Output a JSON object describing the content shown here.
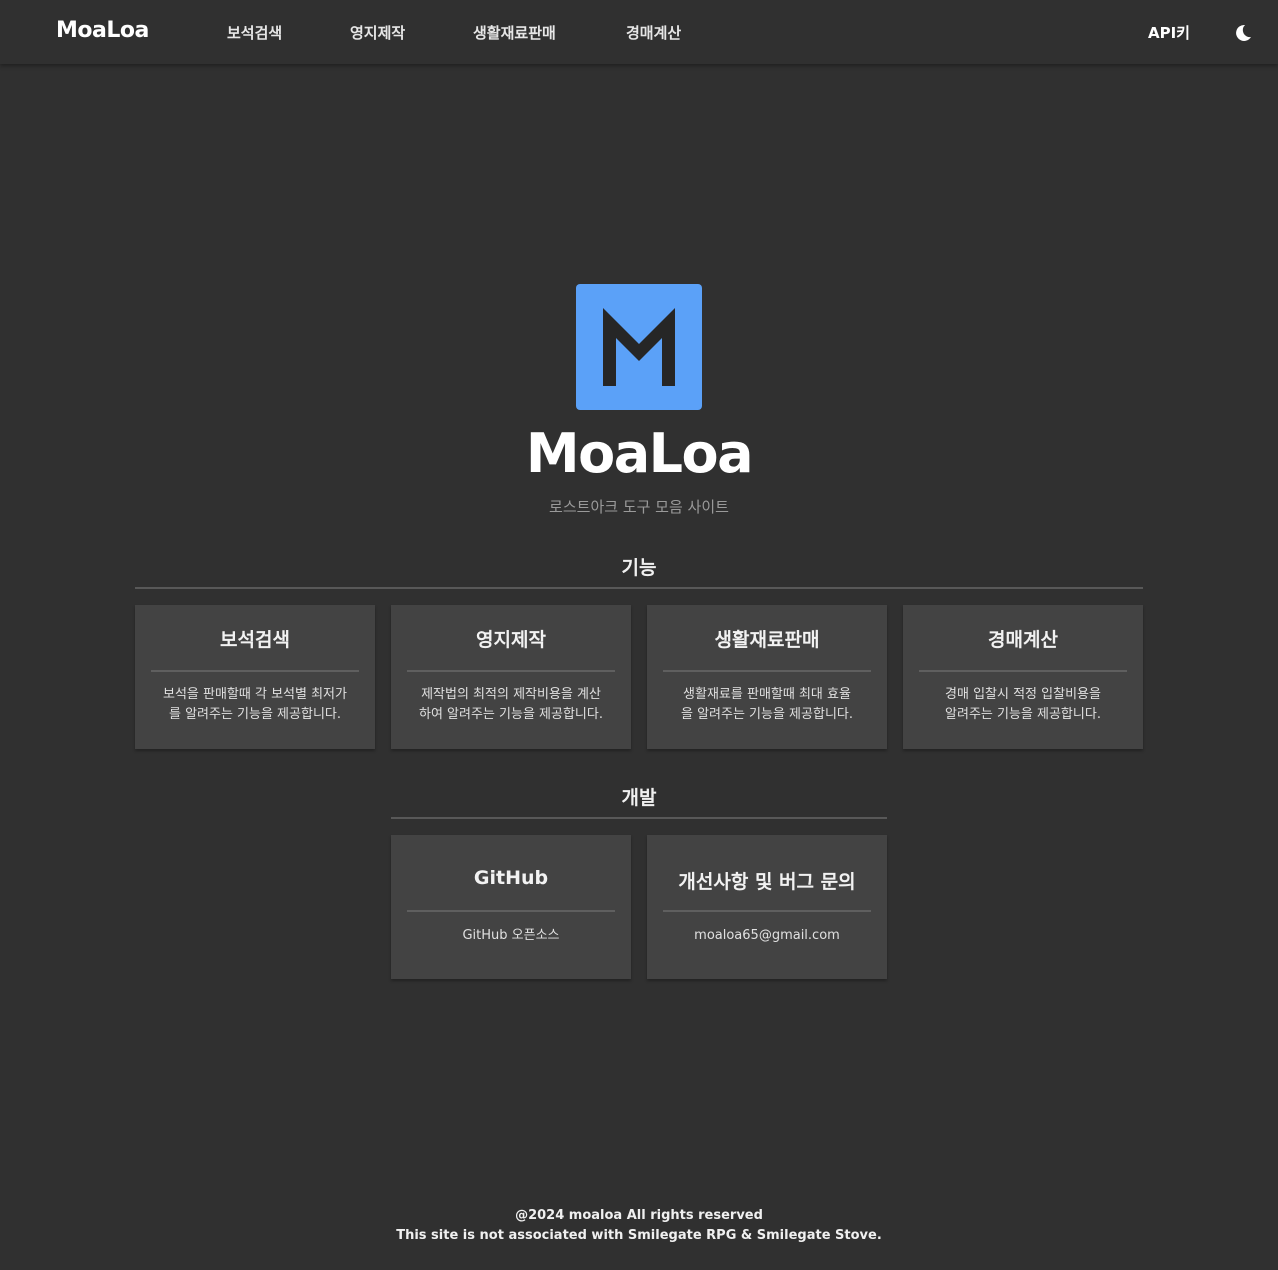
{
  "nav": {
    "brand": "MoaLoa",
    "links": [
      "보석검색",
      "영지제작",
      "생활재료판매",
      "경매계산"
    ],
    "api_label": "API키",
    "theme_icon": "moon-icon"
  },
  "hero": {
    "logo_color": "#5ba1f8",
    "title": "MoaLoa",
    "subtitle": "로스트아크 도구 모음 사이트"
  },
  "features": {
    "heading": "기능",
    "cards": [
      {
        "title": "보석검색",
        "desc_line1": "보석을 판매할때 각 보석별 최저가",
        "desc_line2": "를 알려주는 기능을 제공합니다."
      },
      {
        "title": "영지제작",
        "desc_line1": "제작법의 최적의 제작비용을 계산",
        "desc_line2": "하여 알려주는 기능을 제공합니다."
      },
      {
        "title": "생활재료판매",
        "desc_line1": "생활재료를 판매할때 최대 효율",
        "desc_line2": "을 알려주는 기능을 제공합니다."
      },
      {
        "title": "경매계산",
        "desc_line1": "경매 입찰시 적정 입찰비용을",
        "desc_line2": "알려주는 기능을 제공합니다."
      }
    ]
  },
  "development": {
    "heading": "개발",
    "cards": [
      {
        "title": "GitHub",
        "desc": "GitHub 오픈소스"
      },
      {
        "title": "개선사항 및 버그 문의",
        "desc": "moaloa65@gmail.com"
      }
    ]
  },
  "footer": {
    "line1": "@2024 moaloa All rights reserved",
    "line2": "This site is not associated with Smilegate RPG & Smilegate Stove."
  }
}
